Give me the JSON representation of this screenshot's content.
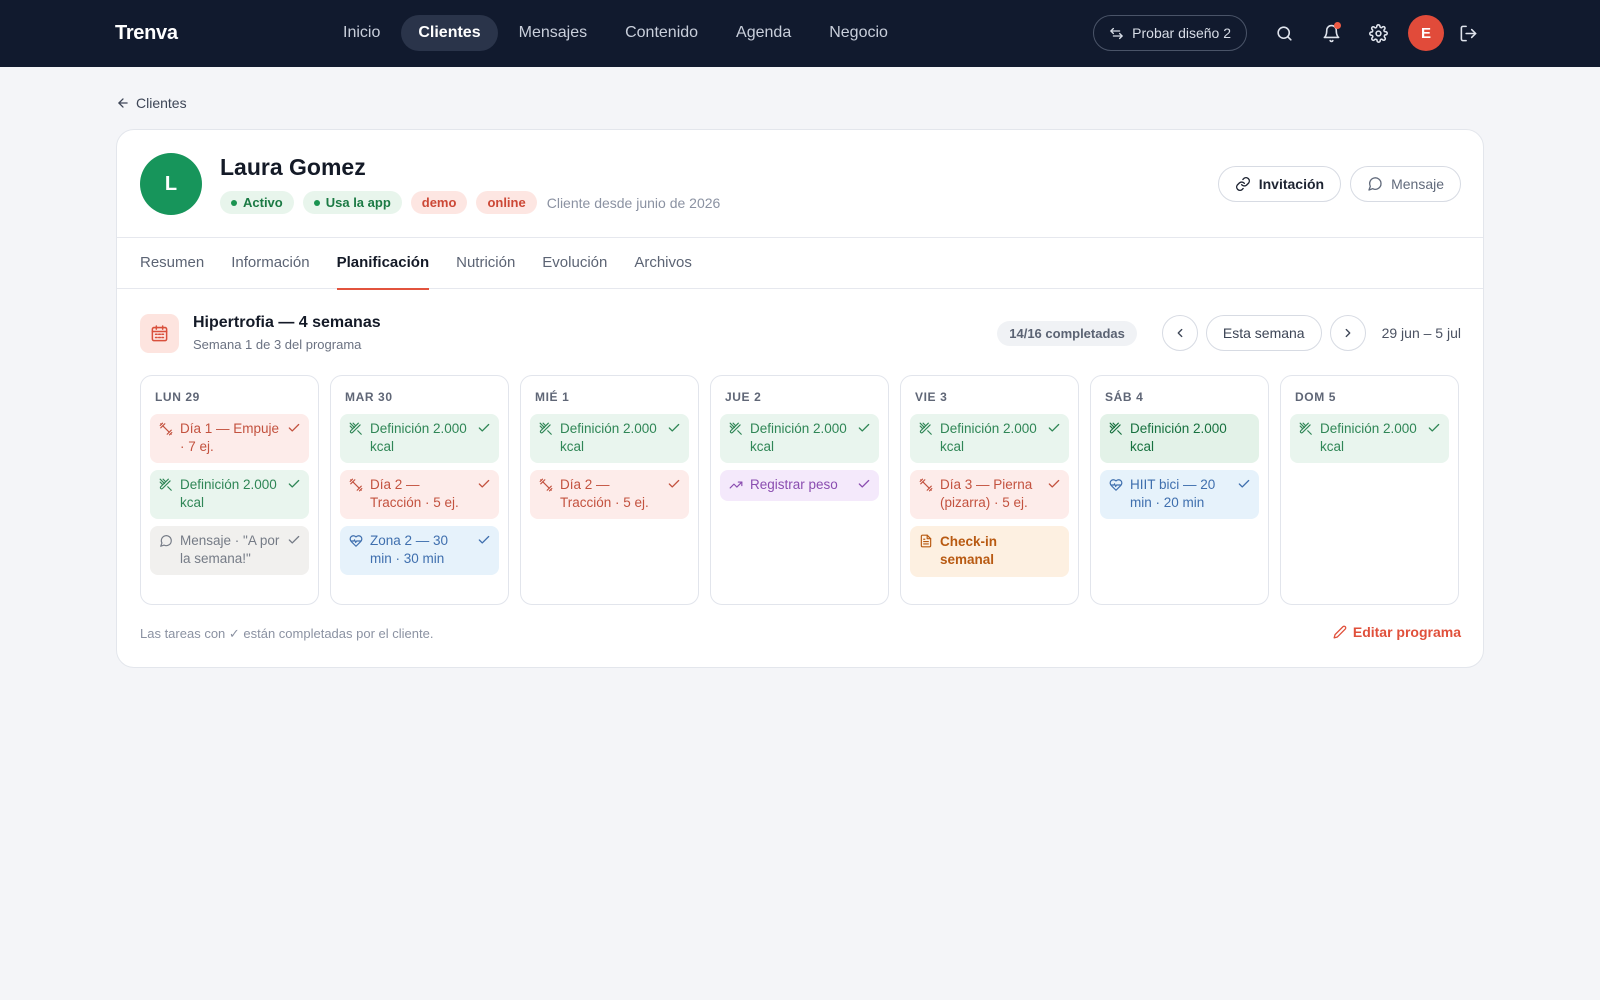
{
  "brand": "Trenva",
  "nav": [
    "Inicio",
    "Clientes",
    "Mensajes",
    "Contenido",
    "Agenda",
    "Negocio"
  ],
  "nav_active": 1,
  "try_design": "Probar diseño 2",
  "user_initial": "E",
  "back_label": "Clientes",
  "client": {
    "initial": "L",
    "name": "Laura Gomez",
    "tag_active": "Activo",
    "tag_app": "Usa la app",
    "tag_demo": "demo",
    "tag_online": "online",
    "since": "Cliente desde junio de 2026",
    "invite_label": "Invitación",
    "message_label": "Mensaje"
  },
  "tabs": [
    "Resumen",
    "Información",
    "Planificación",
    "Nutrición",
    "Evolución",
    "Archivos"
  ],
  "program": {
    "title": "Hipertrofia — 4 semanas",
    "subtitle": "Semana 1 de 3 del programa",
    "completed": "14/16 completadas",
    "this_week": "Esta semana",
    "range": "29 jun – 5 jul"
  },
  "days": [
    {
      "label": "LUN 29",
      "tasks": [
        {
          "text": "Día 1 — Empuje · 7 ej.",
          "kind": "red",
          "icon": "dumbbell-icon",
          "done": true
        },
        {
          "text": "Definición 2.000 kcal",
          "kind": "green",
          "icon": "cutlery-icon",
          "done": true
        },
        {
          "text": "Mensaje · \"A por la semana!\"",
          "kind": "grey",
          "icon": "chat-icon",
          "done": true
        }
      ]
    },
    {
      "label": "MAR 30",
      "tasks": [
        {
          "text": "Definición 2.000 kcal",
          "kind": "green",
          "icon": "cutlery-icon",
          "done": true
        },
        {
          "text": "Día 2 — Tracción · 5 ej.",
          "kind": "red",
          "icon": "dumbbell-icon",
          "done": true
        },
        {
          "text": "Zona 2 — 30 min · 30 min",
          "kind": "blue",
          "icon": "heart-pulse-icon",
          "done": true
        }
      ]
    },
    {
      "label": "MIÉ 1",
      "tasks": [
        {
          "text": "Definición 2.000 kcal",
          "kind": "green",
          "icon": "cutlery-icon",
          "done": true
        },
        {
          "text": "Día 2 — Tracción · 5 ej.",
          "kind": "red",
          "icon": "dumbbell-icon",
          "done": true
        }
      ]
    },
    {
      "label": "JUE 2",
      "tasks": [
        {
          "text": "Definición 2.000 kcal",
          "kind": "green",
          "icon": "cutlery-icon",
          "done": true
        },
        {
          "text": "Registrar peso",
          "kind": "purple",
          "icon": "trend-icon",
          "done": true
        }
      ]
    },
    {
      "label": "VIE 3",
      "tasks": [
        {
          "text": "Definición 2.000 kcal",
          "kind": "green",
          "icon": "cutlery-icon",
          "done": true
        },
        {
          "text": "Día 3 — Pierna (pizarra) · 5 ej.",
          "kind": "red",
          "icon": "dumbbell-icon",
          "done": true
        },
        {
          "text": "Check-in semanal",
          "kind": "orange",
          "icon": "document-icon",
          "done": false
        }
      ]
    },
    {
      "label": "SÁB 4",
      "tasks": [
        {
          "text": "Definición 2.000 kcal",
          "kind": "green-strong",
          "icon": "cutlery-icon",
          "done": false
        },
        {
          "text": "HIIT bici — 20 min · 20 min",
          "kind": "blue",
          "icon": "heart-pulse-icon",
          "done": true
        }
      ]
    },
    {
      "label": "DOM 5",
      "tasks": [
        {
          "text": "Definición 2.000 kcal",
          "kind": "green",
          "icon": "cutlery-icon",
          "done": true
        }
      ]
    }
  ],
  "footnote": "Las tareas con ✓ están completadas por el cliente.",
  "edit_label": "Editar programa"
}
